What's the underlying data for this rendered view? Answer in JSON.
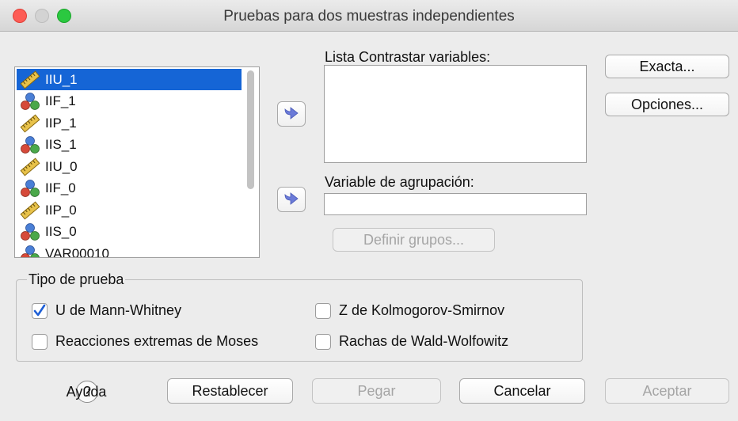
{
  "window": {
    "title": "Pruebas para dos muestras independientes"
  },
  "variable_list": {
    "items": [
      {
        "label": "IIU_1",
        "icon": "ruler-icon",
        "selected": true
      },
      {
        "label": "IIF_1",
        "icon": "nominal-measure-icon",
        "selected": false
      },
      {
        "label": "IIP_1",
        "icon": "ruler-icon",
        "selected": false
      },
      {
        "label": "IIS_1",
        "icon": "nominal-measure-icon",
        "selected": false
      },
      {
        "label": "IIU_0",
        "icon": "ruler-icon",
        "selected": false
      },
      {
        "label": "IIF_0",
        "icon": "nominal-measure-icon",
        "selected": false
      },
      {
        "label": "IIP_0",
        "icon": "ruler-icon",
        "selected": false
      },
      {
        "label": "IIS_0",
        "icon": "nominal-measure-icon",
        "selected": false
      },
      {
        "label": "VAR00010",
        "icon": "nominal-measure-icon",
        "selected": false
      }
    ]
  },
  "test_variables": {
    "label": "Lista Contrastar variables:"
  },
  "grouping": {
    "label": "Variable de agrupación:",
    "value": "",
    "define_groups_label": "Definir grupos..."
  },
  "side_buttons": {
    "exact_label": "Exacta...",
    "options_label": "Opciones..."
  },
  "test_type": {
    "title": "Tipo de prueba",
    "options": [
      {
        "label": "U de Mann-Whitney",
        "checked": true
      },
      {
        "label": "Z de Kolmogorov-Smirnov",
        "checked": false
      },
      {
        "label": "Reacciones extremas de Moses",
        "checked": false
      },
      {
        "label": "Rachas de Wald-Wolfowitz",
        "checked": false
      }
    ]
  },
  "bottom_bar": {
    "help_label": "Ayuda",
    "help_glyph": "?",
    "reset_label": "Restablecer",
    "paste_label": "Pegar",
    "cancel_label": "Cancelar",
    "accept_label": "Aceptar"
  },
  "colors": {
    "selection": "#1565d6",
    "arrow": "#6b7bd8",
    "check": "#1e5fd6"
  }
}
